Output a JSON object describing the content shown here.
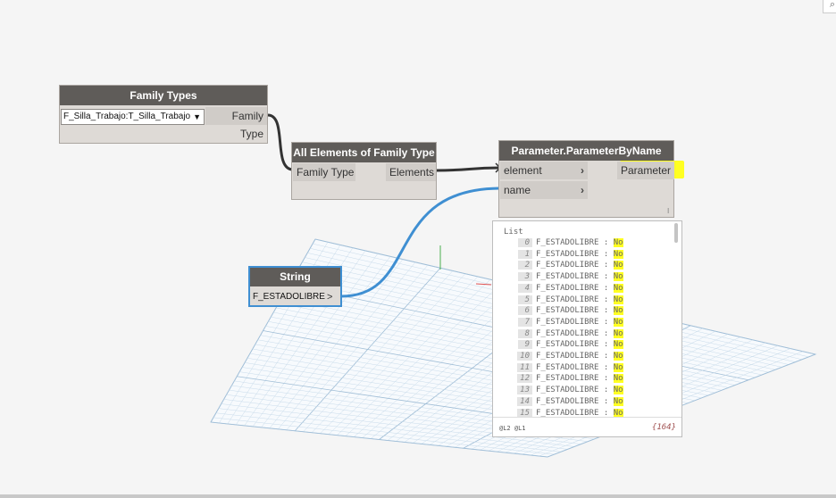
{
  "nodes": {
    "family_types": {
      "title": "Family Types",
      "selected": "F_Silla_Trabajo:T_Silla_Trabajo",
      "output": "Family Type"
    },
    "all_elements": {
      "title": "All Elements of Family Type",
      "input": "Family Type",
      "output": "Elements"
    },
    "param_by_name": {
      "title": "Parameter.ParameterByName",
      "inputs": [
        "element",
        "name"
      ],
      "output": "Parameter",
      "lacing_mark": "l"
    },
    "string": {
      "title": "String",
      "value": "F_ESTADOLIBRE",
      "output_chevron": ">"
    }
  },
  "preview": {
    "header": "List",
    "rows": [
      {
        "index": "0",
        "text": "F_ESTADOLIBRE : ",
        "value": "No"
      },
      {
        "index": "1",
        "text": "F_ESTADOLIBRE : ",
        "value": "No"
      },
      {
        "index": "2",
        "text": "F_ESTADOLIBRE : ",
        "value": "No"
      },
      {
        "index": "3",
        "text": "F_ESTADOLIBRE : ",
        "value": "No"
      },
      {
        "index": "4",
        "text": "F_ESTADOLIBRE : ",
        "value": "No"
      },
      {
        "index": "5",
        "text": "F_ESTADOLIBRE : ",
        "value": "No"
      },
      {
        "index": "6",
        "text": "F_ESTADOLIBRE : ",
        "value": "No"
      },
      {
        "index": "7",
        "text": "F_ESTADOLIBRE : ",
        "value": "No"
      },
      {
        "index": "8",
        "text": "F_ESTADOLIBRE : ",
        "value": "No"
      },
      {
        "index": "9",
        "text": "F_ESTADOLIBRE : ",
        "value": "No"
      },
      {
        "index": "10",
        "text": "F_ESTADOLIBRE : ",
        "value": "No"
      },
      {
        "index": "11",
        "text": "F_ESTADOLIBRE : ",
        "value": "No"
      },
      {
        "index": "12",
        "text": "F_ESTADOLIBRE : ",
        "value": "No"
      },
      {
        "index": "13",
        "text": "F_ESTADOLIBRE : ",
        "value": "No"
      },
      {
        "index": "14",
        "text": "F_ESTADOLIBRE : ",
        "value": "No"
      },
      {
        "index": "15",
        "text": "F_ESTADOLIBRE : ",
        "value": "No"
      }
    ],
    "footer_levels": "@L2 @L1",
    "footer_count": "{164}"
  },
  "colors": {
    "wire_dark": "#333333",
    "wire_blue": "#3f8fd2",
    "highlight": "#ffff22",
    "node_header": "#5f5c59",
    "string_border": "#3f8fd2"
  }
}
